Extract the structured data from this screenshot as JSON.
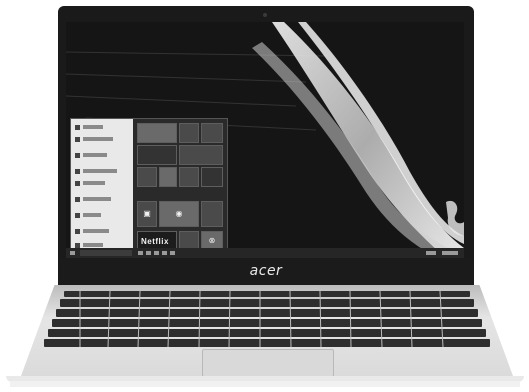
{
  "image": {
    "subject": "laptop-computer",
    "brand_logo": "acer",
    "screen": {
      "start_menu_tiles": [
        "Netflix"
      ]
    }
  },
  "colors": {
    "bezel": "#1a1a1a",
    "screen_bg": "#141414",
    "start_menu_list": "#e9e9e9",
    "tile": "#4a4a4a",
    "chassis": "#cfcfcf"
  }
}
